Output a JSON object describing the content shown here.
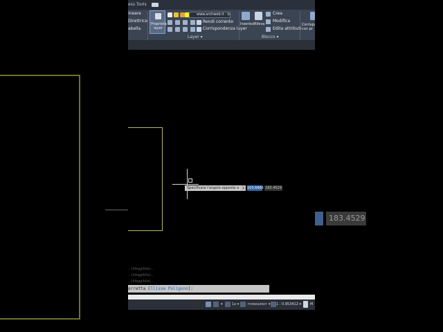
{
  "ribbon": {
    "tab_fragment": "ess Tools",
    "annotation_rows": [
      "ineare",
      "Direttrice",
      "abella"
    ],
    "layer_properties_label": "Proprietà layer",
    "layer_combo_text": "www.archweb.it - bl",
    "make_current_label": "Rendi corrente",
    "match_layer_label": "Corrispondenza layer",
    "layer_group_label": "Layer",
    "insert_label": "Inserisci",
    "edit_label": "Rileva",
    "create_label": "Crea",
    "modify_label": "Modifica",
    "edit_attributes_label": "Edita attributi",
    "block_group_label": "Blocco",
    "properties_fragment": "Corrispo con pr"
  },
  "drawing": {
    "tooltip_text": "Specificare l'angolo opposto o",
    "tooltip_arrow": "↓",
    "dyn_input_value": "103.6666",
    "dyn_input_second": "183.4529",
    "ghost_value": "183.4529"
  },
  "command": {
    "history": [
      "...(illeggibile)...",
      "...(illeggibile)...",
      "...(illeggibile)..."
    ],
    "prefix": "orretta",
    "option1": "Ellisse",
    "option2": "Poligono",
    "suffix": "]:"
  },
  "status": {
    "annotation_scale": "<nessuno>",
    "scale_value": "1 : 0.853412",
    "model_label": "M"
  },
  "colors": {
    "ribbon_bg": "#3b4453",
    "drawing_line": "#b9bb68",
    "dyn_input_bg": "#3465a4",
    "command_bg": "#c6c6c6"
  }
}
